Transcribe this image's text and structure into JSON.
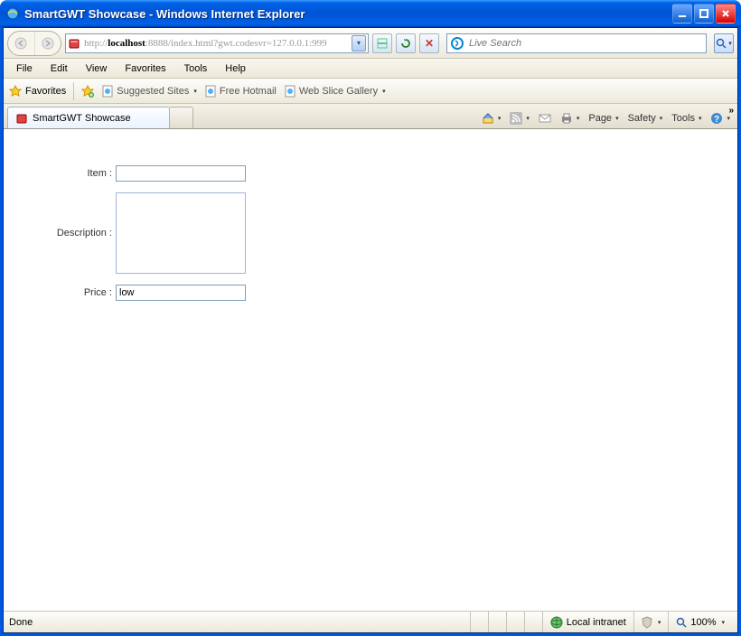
{
  "titlebar": {
    "title": "SmartGWT Showcase - Windows Internet Explorer"
  },
  "nav": {
    "url_gray_prefix": "http://",
    "url_host": "localhost",
    "url_gray_suffix": ":8888/index.html?gwt.codesvr=127.0.0.1:999",
    "search_placeholder": "Live Search"
  },
  "menu": {
    "items": [
      "File",
      "Edit",
      "View",
      "Favorites",
      "Tools",
      "Help"
    ]
  },
  "linksbar": {
    "favorites_label": "Favorites",
    "suggested": "Suggested Sites",
    "hotmail": "Free Hotmail",
    "webslice": "Web Slice Gallery"
  },
  "tabs": {
    "active": "SmartGWT Showcase"
  },
  "cmdbar": {
    "page": "Page",
    "safety": "Safety",
    "tools": "Tools"
  },
  "form": {
    "item_label": "Item :",
    "item_value": "",
    "description_label": "Description :",
    "description_value": "",
    "price_label": "Price :",
    "price_value": "low"
  },
  "status": {
    "done": "Done",
    "zone": "Local intranet",
    "zoom": "100%"
  },
  "colors": {
    "xp_blue": "#0054d8",
    "field_border": "#7f9db9"
  }
}
